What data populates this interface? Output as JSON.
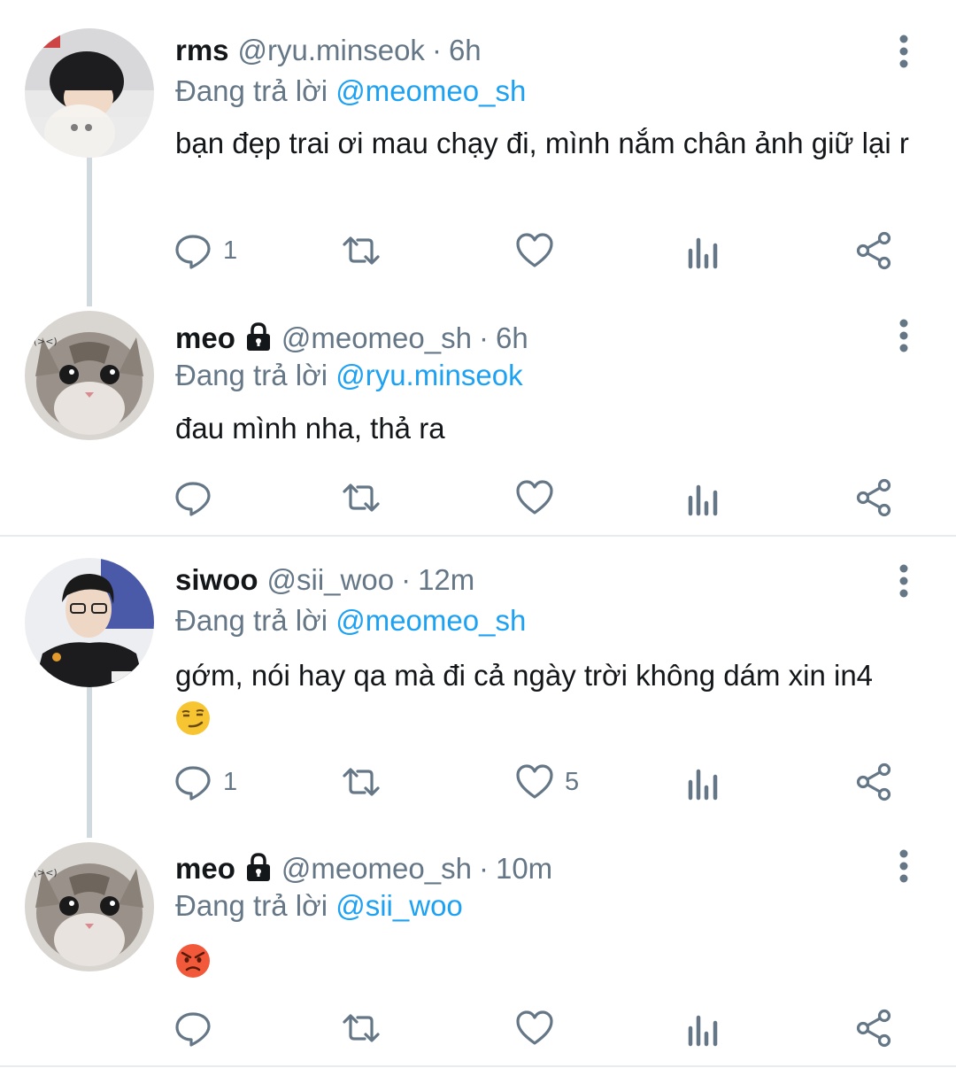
{
  "tweets": [
    {
      "name": "rms",
      "handle": "@ryu.minseok",
      "dot": "·",
      "time": "6h",
      "locked": false,
      "replying_prefix": "Đang trả lời",
      "replying_to": "@meomeo_sh",
      "text": "bạn đẹp trai ơi mau chạy đi, mình nắm chân ảnh giữ lại r",
      "reply_count": "1",
      "like_count": ""
    },
    {
      "name": "meo",
      "handle": "@meomeo_sh",
      "dot": "·",
      "time": "6h",
      "locked": true,
      "replying_prefix": "Đang trả lời",
      "replying_to": "@ryu.minseok",
      "text": "đau mình nha, thả ra",
      "reply_count": "",
      "like_count": ""
    },
    {
      "name": "siwoo",
      "handle": "@sii_woo",
      "dot": "·",
      "time": "12m",
      "locked": false,
      "replying_prefix": "Đang trả lời",
      "replying_to": "@meomeo_sh",
      "text": "gớm, nói hay qa mà đi cả ngày trời không dám xin in4",
      "emoji": "smirk-emoji",
      "reply_count": "1",
      "like_count": "5"
    },
    {
      "name": "meo",
      "handle": "@meomeo_sh",
      "dot": "·",
      "time": "10m",
      "locked": true,
      "replying_prefix": "Đang trả lời",
      "replying_to": "@sii_woo",
      "text": "",
      "emoji": "angry-emoji",
      "reply_count": "",
      "like_count": ""
    }
  ],
  "colors": {
    "text": "#14171a",
    "secondary": "#657786",
    "mention": "#1da1f2",
    "thread_line": "#cfd9de",
    "divider": "#e6ecf0"
  }
}
